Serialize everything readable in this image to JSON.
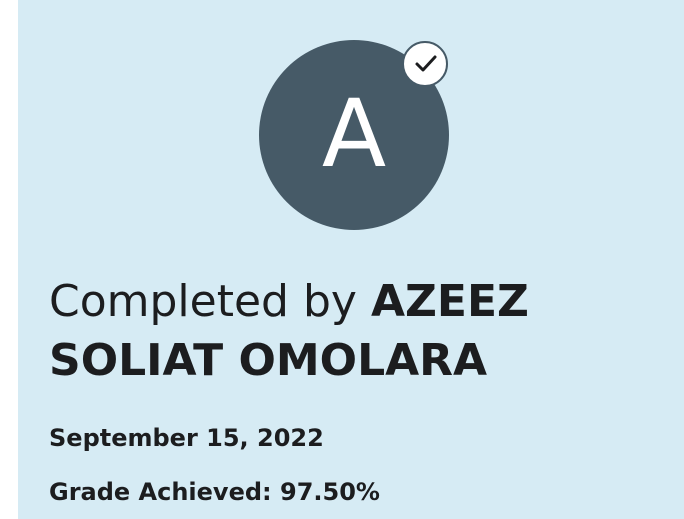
{
  "avatar": {
    "initial": "A",
    "background": "#465a67",
    "badge_icon": "checkmark-icon"
  },
  "certificate": {
    "completed_prefix": "Completed by",
    "learner_name": "AZEEZ SOLIAT OMOLARA",
    "date": "September 15, 2022",
    "grade": "Grade Achieved: 97.50%"
  },
  "colors": {
    "card_background": "#d6ebf4",
    "text": "#1c1d1f"
  }
}
